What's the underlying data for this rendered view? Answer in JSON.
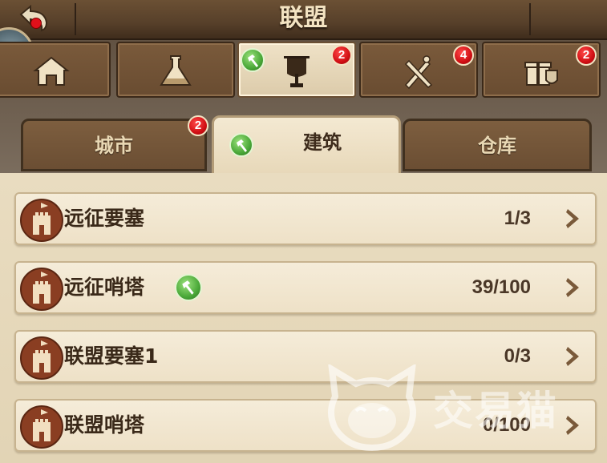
{
  "header": {
    "title": "联盟",
    "back_icon": "back-arrow-icon",
    "notification_dot_color": "#e0101a"
  },
  "category_tabs": [
    {
      "id": "city",
      "icon": "house-icon",
      "badge": null,
      "active": false
    },
    {
      "id": "research",
      "icon": "flask-icon",
      "badge": null,
      "active": false
    },
    {
      "id": "banner",
      "icon": "banner-icon",
      "badge": "2",
      "hammer": true,
      "active": true
    },
    {
      "id": "war",
      "icon": "crossed-weapons-icon",
      "badge": "4",
      "active": false
    },
    {
      "id": "gifts",
      "icon": "gift-icon",
      "badge": "2",
      "active": false
    }
  ],
  "sub_tabs": [
    {
      "label": "城市",
      "badge": "2",
      "active": false
    },
    {
      "label": "建筑",
      "hammer": true,
      "active": true
    },
    {
      "label": "仓库",
      "active": false
    }
  ],
  "buildings": [
    {
      "name": "远征要塞",
      "count": "1/3",
      "hammer": false
    },
    {
      "name": "远征哨塔",
      "count": "39/100",
      "hammer": true
    },
    {
      "name": "联盟要塞1",
      "count": "0/3",
      "hammer": false
    },
    {
      "name": "联盟哨塔",
      "count": "0/100",
      "hammer": false
    }
  ],
  "watermark": {
    "text": "交易猫",
    "icon": "cat-logo-icon"
  },
  "colors": {
    "badge_red": "#d10f14",
    "hammer_green": "#4aa838",
    "active_tab": "#efe2c7",
    "inactive_tab": "#6b4e33"
  }
}
